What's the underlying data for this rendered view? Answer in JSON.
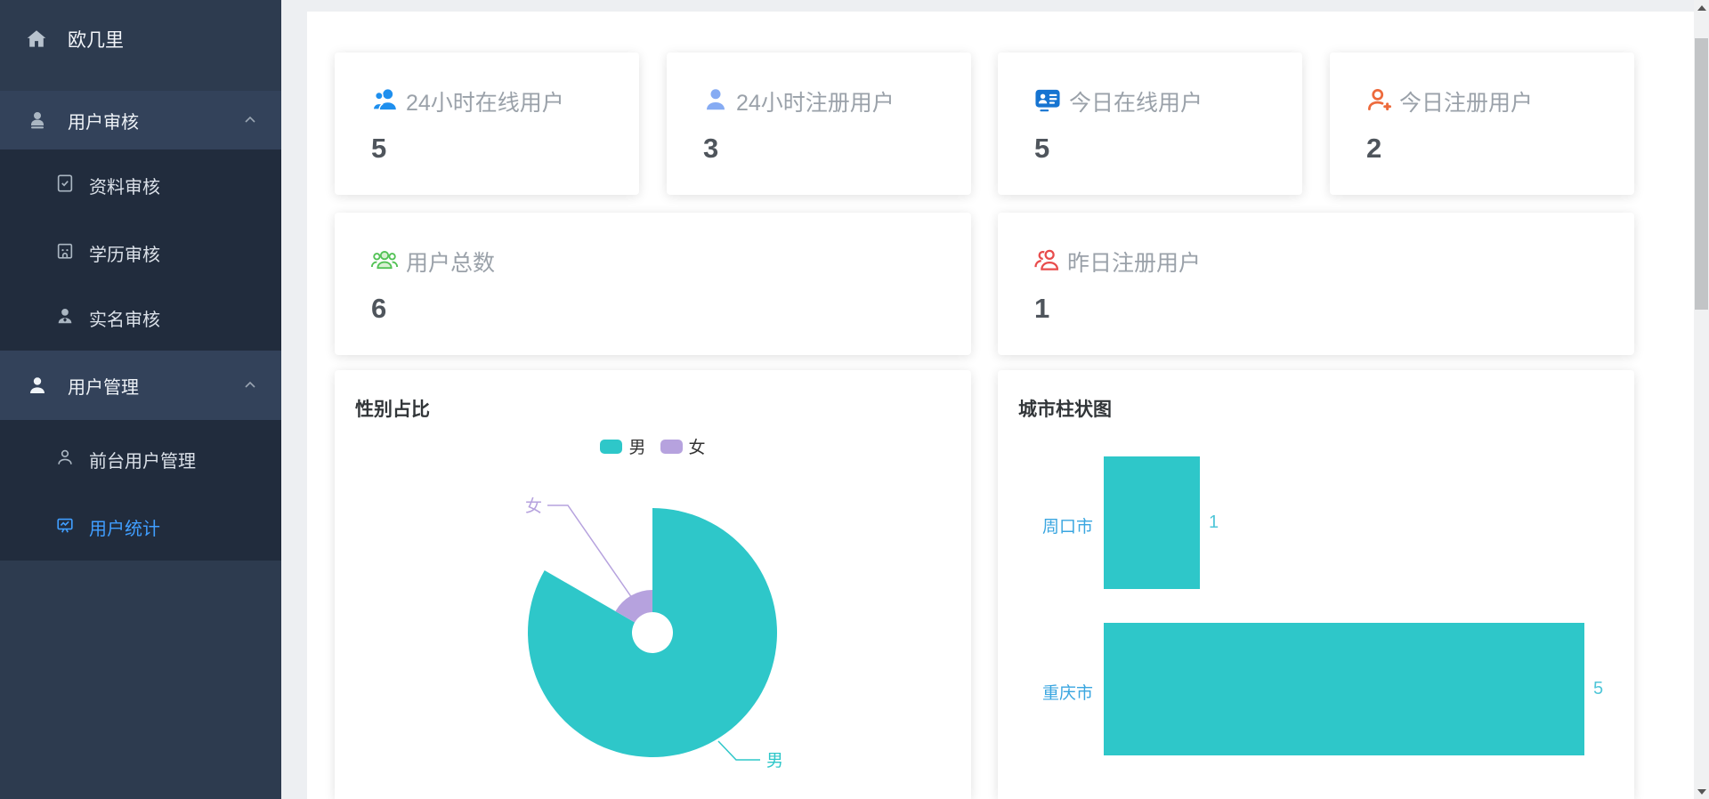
{
  "sidebar": {
    "logo": {
      "label": "欧几里"
    },
    "groups": [
      {
        "label": "用户审核",
        "expanded": true,
        "children": [
          {
            "label": "资料审核"
          },
          {
            "label": "学历审核"
          },
          {
            "label": "实名审核"
          }
        ]
      },
      {
        "label": "用户管理",
        "expanded": true,
        "children": [
          {
            "label": "前台用户管理"
          },
          {
            "label": "用户统计",
            "active": true
          }
        ]
      }
    ],
    "colors": {
      "bg": "#2d3b4f",
      "band_bg": "#33425a",
      "submenu_bg": "#212c3d",
      "active_text": "#409eff"
    }
  },
  "stat_cards": [
    {
      "label": "24小时在线用户",
      "value": "5",
      "icon": "users-filled-icon",
      "icon_color": "#1e8fee"
    },
    {
      "label": "24小时注册用户",
      "value": "3",
      "icon": "user-filled-icon",
      "icon_color": "#86abf3"
    },
    {
      "label": "今日在线用户",
      "value": "5",
      "icon": "id-card-icon",
      "icon_color": "#1674d1"
    },
    {
      "label": "今日注册用户",
      "value": "2",
      "icon": "user-plus-icon",
      "icon_color": "#ed6a3c"
    },
    {
      "label": "用户总数",
      "value": "6",
      "icon": "user-group-icon",
      "icon_color": "#52c255"
    },
    {
      "label": "昨日注册用户",
      "value": "1",
      "icon": "users-outline-icon",
      "icon_color": "#e84c4c"
    }
  ],
  "pie_card": {
    "title": "性别占比",
    "legend": [
      {
        "label": "男",
        "color": "#2ec7c9"
      },
      {
        "label": "女",
        "color": "#b6a2de"
      }
    ],
    "slice_labels": {
      "male": "男",
      "female": "女"
    }
  },
  "bar_card": {
    "title": "城市柱状图",
    "rows": [
      {
        "category": "周口市",
        "value": "1"
      },
      {
        "category": "重庆市",
        "value": "5"
      }
    ]
  },
  "chart_data": [
    {
      "type": "pie",
      "title": "性别占比",
      "style": "rose-donut",
      "legend_position": "top-center",
      "series": [
        {
          "name": "男",
          "value": 5,
          "color": "#2ec7c9"
        },
        {
          "name": "女",
          "value": 1,
          "color": "#b6a2de"
        }
      ]
    },
    {
      "type": "bar",
      "title": "城市柱状图",
      "orientation": "horizontal",
      "categories": [
        "周口市",
        "重庆市"
      ],
      "values": [
        1,
        5
      ],
      "bar_color": "#2ec7c9",
      "category_label_color": "#3aa6e0",
      "value_label_color": "#4fc6d8",
      "value_labels_shown": true,
      "grid": false,
      "xlim": [
        0,
        5
      ]
    }
  ],
  "scrollbar": {
    "thumb_color": "#c2c4c6",
    "track_color": "#f0f1f2"
  }
}
